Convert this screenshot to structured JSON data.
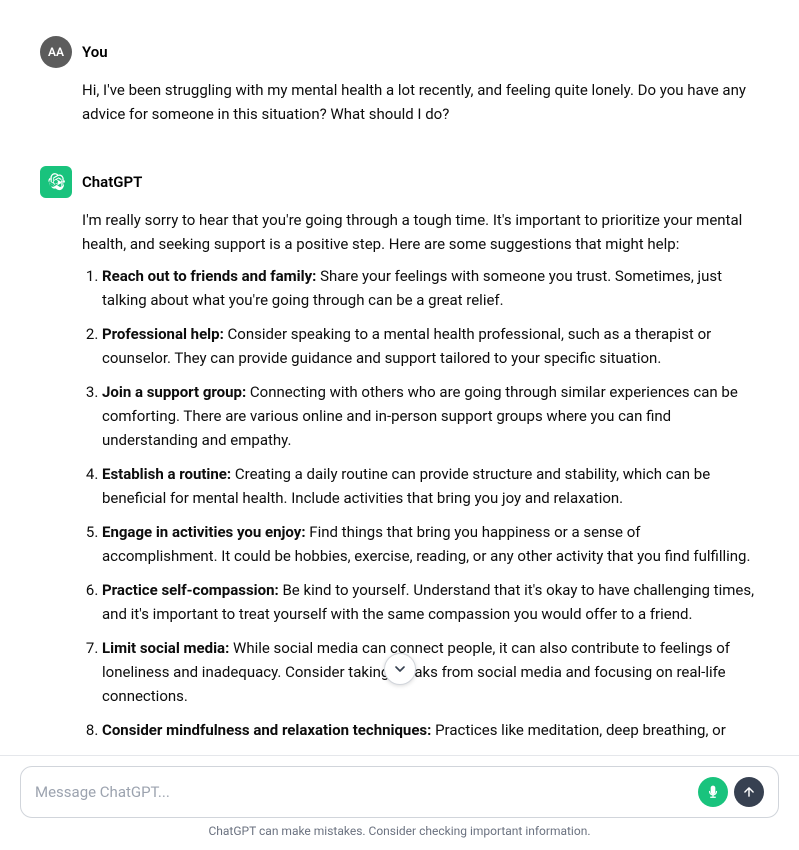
{
  "user": {
    "name": "You",
    "avatar_initials": "AA",
    "message": "Hi, I've been struggling with my mental health a lot recently, and feeling quite lonely. Do you have any advice for someone in this situation? What should I do?"
  },
  "chatgpt": {
    "name": "ChatGPT",
    "intro": "I'm really sorry to hear that you're going through a tough time. It's important to prioritize your mental health, and seeking support is a positive step. Here are some suggestions that might help:",
    "suggestions": [
      {
        "bold": "Reach out to friends and family:",
        "text": " Share your feelings with someone you trust. Sometimes, just talking about what you're going through can be a great relief."
      },
      {
        "bold": "Professional help:",
        "text": " Consider speaking to a mental health professional, such as a therapist or counselor. They can provide guidance and support tailored to your specific situation."
      },
      {
        "bold": "Join a support group:",
        "text": " Connecting with others who are going through similar experiences can be comforting. There are various online and in-person support groups where you can find understanding and empathy."
      },
      {
        "bold": "Establish a routine:",
        "text": " Creating a daily routine can provide structure and stability, which can be beneficial for mental health. Include activities that bring you joy and relaxation."
      },
      {
        "bold": "Engage in activities you enjoy:",
        "text": " Find things that bring you happiness or a sense of accomplishment. It could be hobbies, exercise, reading, or any other activity that you find fulfilling."
      },
      {
        "bold": "Practice self-compassion:",
        "text": " Be kind to yourself. Understand that it's okay to have challenging times, and it's important to treat yourself with the same compassion you would offer to a friend."
      },
      {
        "bold": "Limit social media:",
        "text": " While social media can connect people, it can also contribute to feelings of loneliness and inadequacy. Consider taking breaks from social media and focusing on real-life connections."
      },
      {
        "bold": "Consider mindfulness and relaxation techniques:",
        "text": " Practices like meditation, deep breathing, or"
      }
    ]
  },
  "input": {
    "placeholder": "Message ChatGPT..."
  },
  "disclaimer": "ChatGPT can make mistakes. Consider checking important information.",
  "scroll_down_label": "scroll down",
  "icons": {
    "microphone": "mic-icon",
    "send": "send-icon"
  }
}
